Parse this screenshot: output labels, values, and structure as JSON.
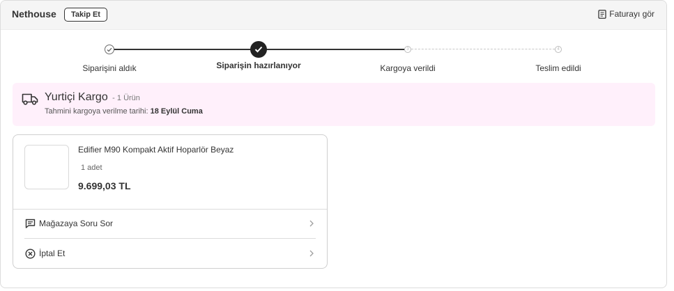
{
  "header": {
    "store_name": "Nethouse",
    "follow_label": "Takip Et",
    "invoice_label": "Faturayı gör"
  },
  "stepper": {
    "steps": [
      {
        "label": "Siparişini aldık",
        "status": "done",
        "marker": ""
      },
      {
        "label": "Siparişin hazırlanıyor",
        "status": "active",
        "marker": ""
      },
      {
        "label": "Kargoya verildi",
        "status": "pending",
        "marker": "3"
      },
      {
        "label": "Teslim edildi",
        "status": "pending",
        "marker": "4"
      }
    ]
  },
  "shipment": {
    "carrier": "Yurtiçi Kargo",
    "item_count": "- 1 Ürün",
    "estimate_label": "Tahmini kargoya verilme tarihi:",
    "estimate_date": "18 Eylül Cuma"
  },
  "product": {
    "title": "Edifier M90 Kompakt Aktif Hoparlör Beyaz",
    "quantity": "1 adet",
    "price": "9.699,03 TL"
  },
  "actions": [
    {
      "label": "Mağazaya Soru Sor",
      "icon": "message-icon"
    },
    {
      "label": "İptal Et",
      "icon": "cancel-circle-icon"
    }
  ],
  "colors": {
    "shipment_bg": "#fff0fb",
    "active_step": "#222222",
    "pending_step": "#bdbdbd"
  }
}
